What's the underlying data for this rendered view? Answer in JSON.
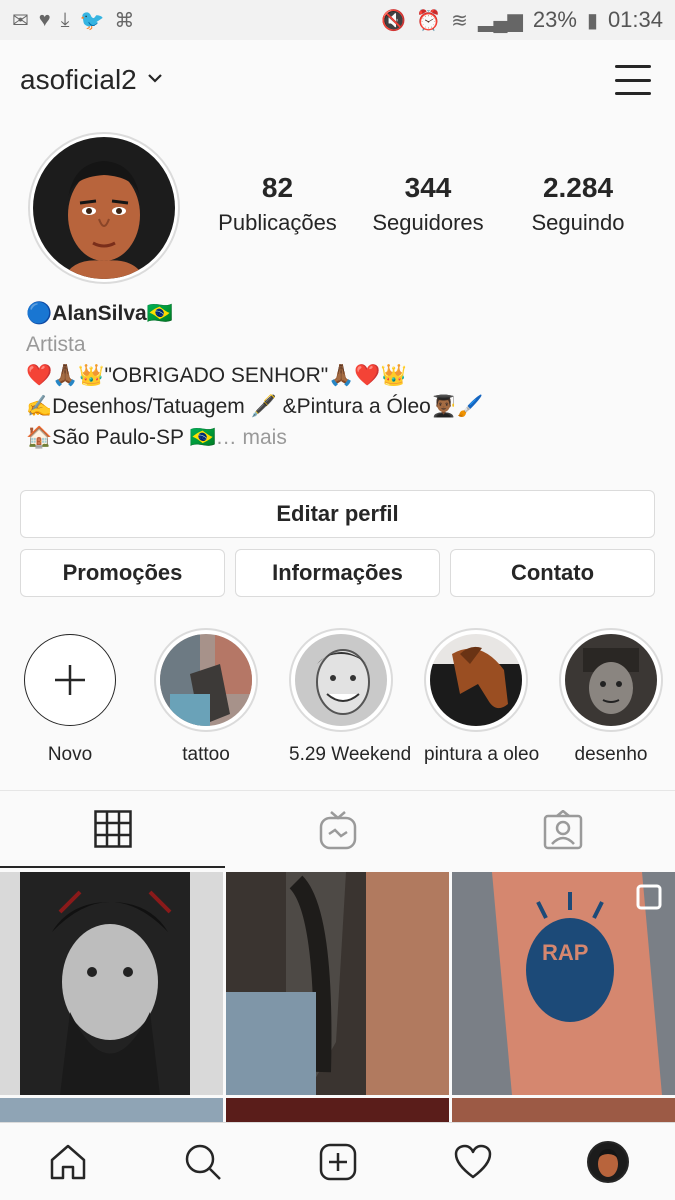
{
  "status_bar": {
    "battery": "23%",
    "time": "01:34"
  },
  "header": {
    "username": "asoficial2"
  },
  "stats": [
    {
      "value": "82",
      "label": "Publicações"
    },
    {
      "value": "344",
      "label": "Seguidores"
    },
    {
      "value": "2.284",
      "label": "Seguindo"
    }
  ],
  "bio": {
    "name_prefix": "🔵",
    "name": "AlanSilva",
    "name_suffix": "🇧🇷",
    "category": "Artista",
    "line1": "❤️🙏🏾👑\"OBRIGADO SENHOR\"🙏🏾❤️👑",
    "line2": "✍️Desenhos/Tatuagem 🖋️ &Pintura a Óleo👨🏾‍🎓🖌️",
    "line3": "🏠São Paulo-SP 🇧🇷",
    "more": "… mais"
  },
  "buttons": {
    "edit_profile": "Editar perfil",
    "promotions": "Promoções",
    "insights": "Informações",
    "contact": "Contato"
  },
  "highlights": [
    {
      "label": "Novo"
    },
    {
      "label": "tattoo"
    },
    {
      "label": "5.29 Weekend"
    },
    {
      "label": "pintura a oleo"
    },
    {
      "label": "desenho"
    }
  ]
}
